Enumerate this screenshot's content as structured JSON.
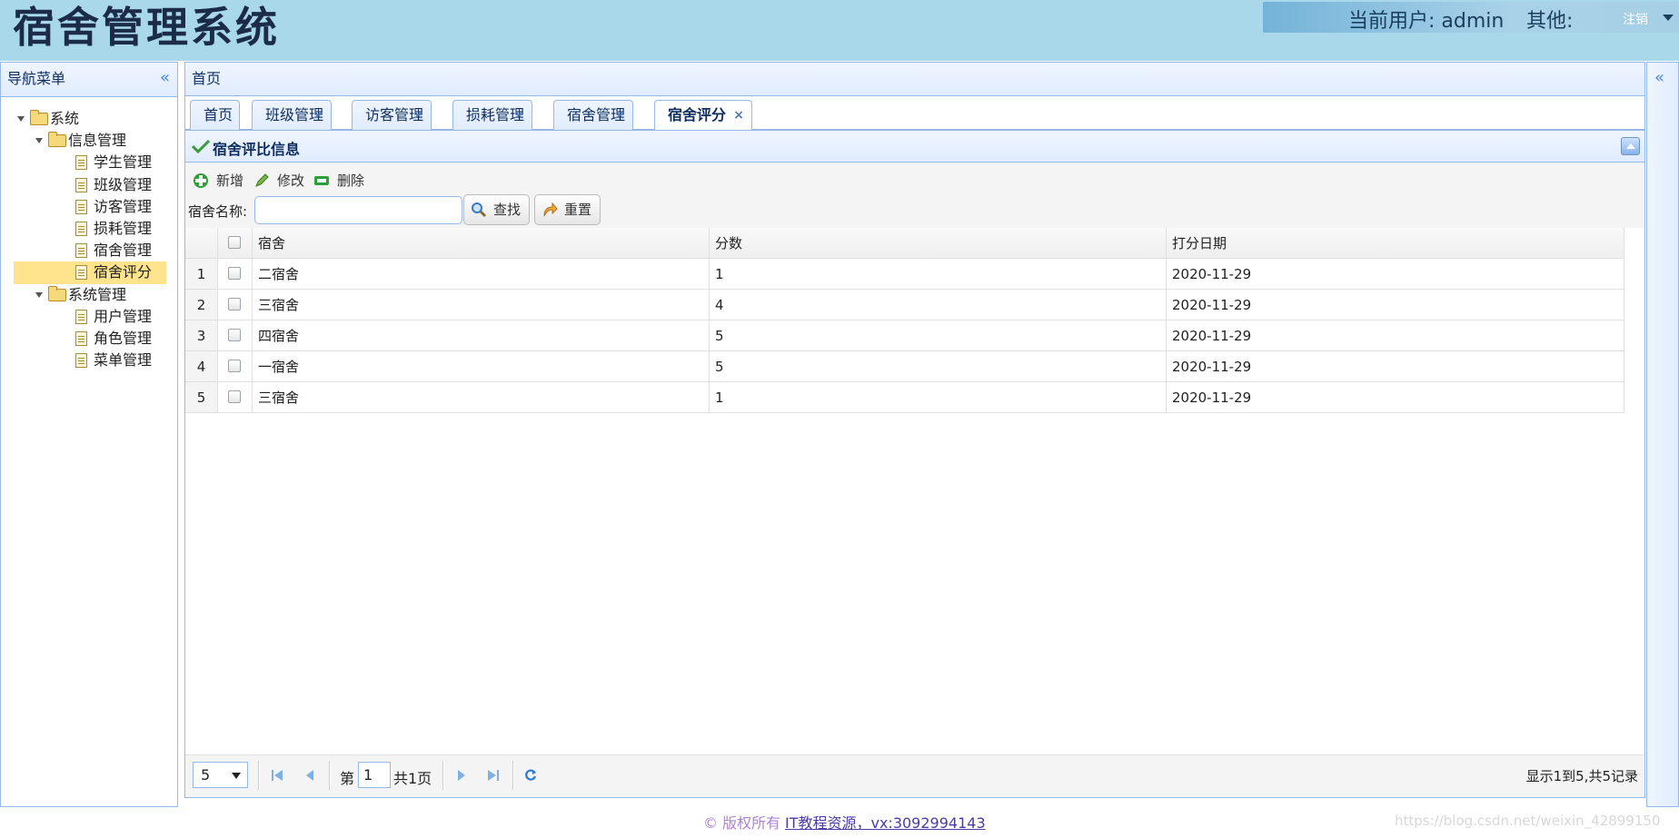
{
  "header": {
    "title": "宿舍管理系统",
    "current_user_label": "当前用户: admin",
    "other_label": "其他:",
    "logout_label": "注销"
  },
  "sidebar": {
    "title": "导航菜单",
    "collapse_icon": "double-chevron-left-icon",
    "root": {
      "label": "系统"
    },
    "groups": [
      {
        "label": "信息管理",
        "items": [
          "学生管理",
          "班级管理",
          "访客管理",
          "损耗管理",
          "宿舍管理",
          "宿舍评分"
        ]
      },
      {
        "label": "系统管理",
        "items": [
          "用户管理",
          "角色管理",
          "菜单管理"
        ]
      }
    ],
    "selected": "宿舍评分"
  },
  "center": {
    "title": "首页",
    "tabs": [
      {
        "label": "首页",
        "closable": false
      },
      {
        "label": "班级管理",
        "closable": true
      },
      {
        "label": "访客管理",
        "closable": true
      },
      {
        "label": "损耗管理",
        "closable": true
      },
      {
        "label": "宿舍管理",
        "closable": true
      },
      {
        "label": "宿舍评分",
        "closable": true,
        "active": true
      }
    ],
    "close_glyph": "×"
  },
  "grid": {
    "title": "宿舍评比信息",
    "toolbar": {
      "add": "新增",
      "edit": "修改",
      "delete": "删除"
    },
    "search": {
      "label": "宿舍名称:",
      "value": "",
      "search_button": "查找",
      "reset_button": "重置"
    },
    "columns": [
      "宿舍",
      "分数",
      "打分日期"
    ],
    "rows": [
      {
        "n": "1",
        "dorm": "二宿舍",
        "score": "1",
        "date": "2020-11-29"
      },
      {
        "n": "2",
        "dorm": "三宿舍",
        "score": "4",
        "date": "2020-11-29"
      },
      {
        "n": "3",
        "dorm": "四宿舍",
        "score": "5",
        "date": "2020-11-29"
      },
      {
        "n": "4",
        "dorm": "一宿舍",
        "score": "5",
        "date": "2020-11-29"
      },
      {
        "n": "5",
        "dorm": "三宿舍",
        "score": "1",
        "date": "2020-11-29"
      }
    ],
    "pager": {
      "page_size": "5",
      "page_prefix": "第",
      "page_number": "1",
      "page_total": "共1页",
      "info": "显示1到5,共5记录"
    }
  },
  "footer": {
    "copyright": "© 版权所有",
    "link": "IT教程资源，vx:3092994143",
    "watermark": "https://blog.csdn.net/weixin_42899150"
  },
  "colors": {
    "header_bg": "#a8d8ea",
    "border": "#95b8e7",
    "selected_node": "#ffe48d"
  }
}
